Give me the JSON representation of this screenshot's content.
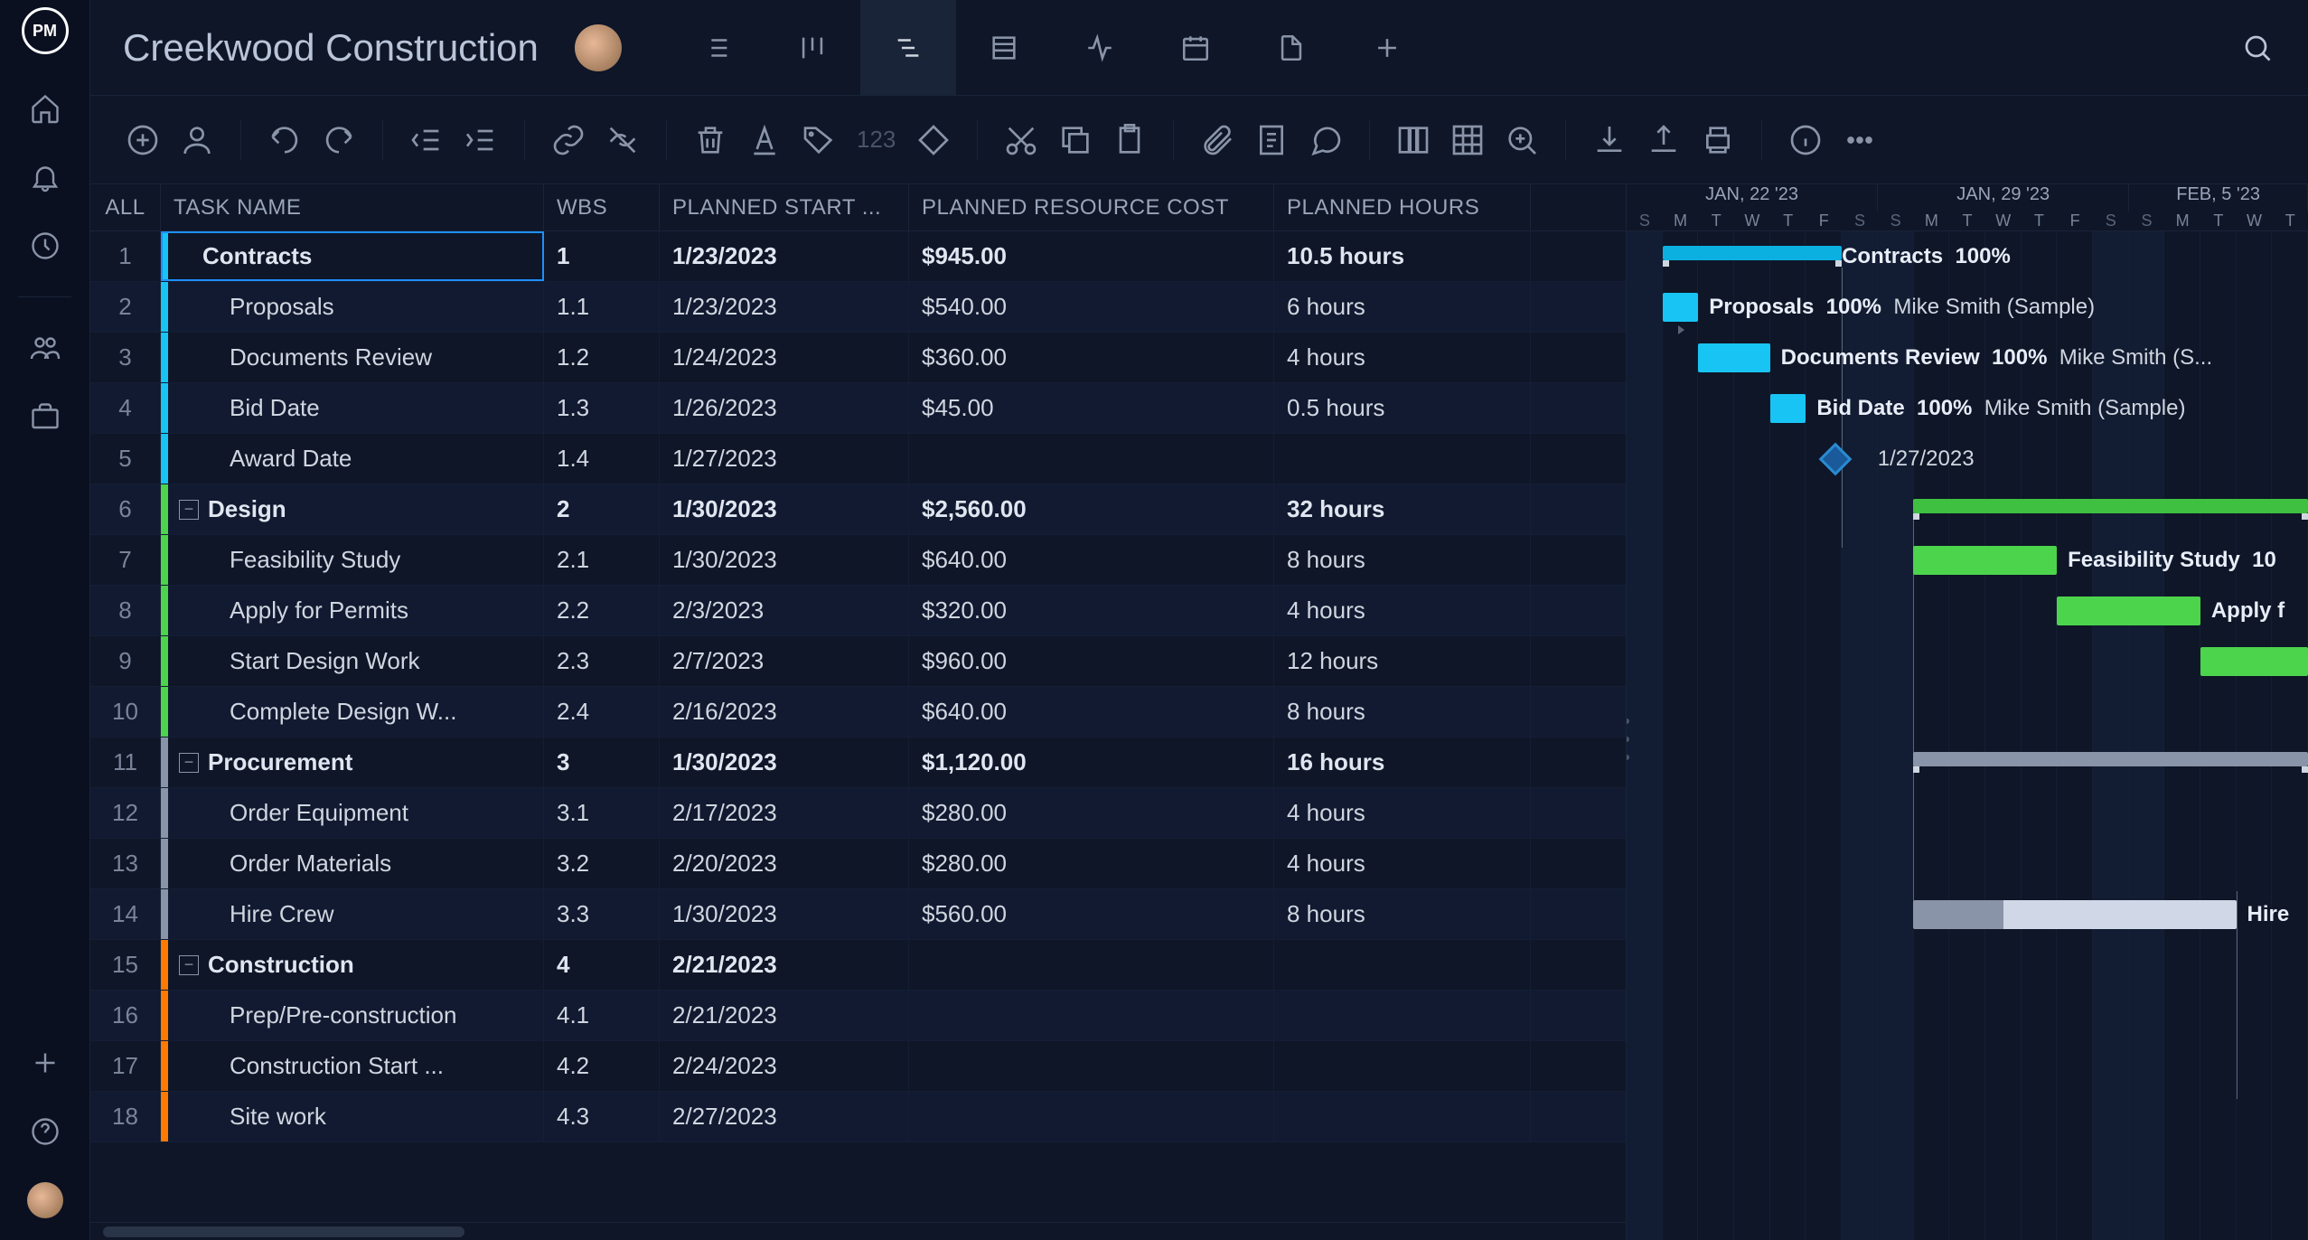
{
  "project": {
    "title": "Creekwood Construction"
  },
  "left_rail": {
    "logo": "PM",
    "items": [
      "home",
      "notifications",
      "activity",
      "",
      "users",
      "briefcase",
      "",
      "add",
      "",
      "help",
      "avatar"
    ]
  },
  "columns": {
    "row": "ALL",
    "task": "TASK NAME",
    "wbs": "WBS",
    "start": "PLANNED START ...",
    "cost": "PLANNED RESOURCE COST",
    "hours": "PLANNED HOURS"
  },
  "tasks": [
    {
      "n": 1,
      "name": "Contracts",
      "wbs": "1",
      "start": "1/23/2023",
      "cost": "$945.00",
      "hours": "10.5 hours",
      "color": "#18c4f4",
      "bold": true,
      "indent": 1,
      "selected": true
    },
    {
      "n": 2,
      "name": "Proposals",
      "wbs": "1.1",
      "start": "1/23/2023",
      "cost": "$540.00",
      "hours": "6 hours",
      "color": "#18c4f4",
      "indent": 2
    },
    {
      "n": 3,
      "name": "Documents Review",
      "wbs": "1.2",
      "start": "1/24/2023",
      "cost": "$360.00",
      "hours": "4 hours",
      "color": "#18c4f4",
      "indent": 2
    },
    {
      "n": 4,
      "name": "Bid Date",
      "wbs": "1.3",
      "start": "1/26/2023",
      "cost": "$45.00",
      "hours": "0.5 hours",
      "color": "#18c4f4",
      "indent": 2
    },
    {
      "n": 5,
      "name": "Award Date",
      "wbs": "1.4",
      "start": "1/27/2023",
      "cost": "",
      "hours": "",
      "color": "#18c4f4",
      "indent": 2
    },
    {
      "n": 6,
      "name": "Design",
      "wbs": "2",
      "start": "1/30/2023",
      "cost": "$2,560.00",
      "hours": "32 hours",
      "color": "#4cd44c",
      "bold": true,
      "indent": 0,
      "collapse": true
    },
    {
      "n": 7,
      "name": "Feasibility Study",
      "wbs": "2.1",
      "start": "1/30/2023",
      "cost": "$640.00",
      "hours": "8 hours",
      "color": "#4cd44c",
      "indent": 2
    },
    {
      "n": 8,
      "name": "Apply for Permits",
      "wbs": "2.2",
      "start": "2/3/2023",
      "cost": "$320.00",
      "hours": "4 hours",
      "color": "#4cd44c",
      "indent": 2
    },
    {
      "n": 9,
      "name": "Start Design Work",
      "wbs": "2.3",
      "start": "2/7/2023",
      "cost": "$960.00",
      "hours": "12 hours",
      "color": "#4cd44c",
      "indent": 2
    },
    {
      "n": 10,
      "name": "Complete Design W...",
      "wbs": "2.4",
      "start": "2/16/2023",
      "cost": "$640.00",
      "hours": "8 hours",
      "color": "#4cd44c",
      "indent": 2
    },
    {
      "n": 11,
      "name": "Procurement",
      "wbs": "3",
      "start": "1/30/2023",
      "cost": "$1,120.00",
      "hours": "16 hours",
      "color": "#8a94a8",
      "bold": true,
      "indent": 0,
      "collapse": true
    },
    {
      "n": 12,
      "name": "Order Equipment",
      "wbs": "3.1",
      "start": "2/17/2023",
      "cost": "$280.00",
      "hours": "4 hours",
      "color": "#8a94a8",
      "indent": 2
    },
    {
      "n": 13,
      "name": "Order Materials",
      "wbs": "3.2",
      "start": "2/20/2023",
      "cost": "$280.00",
      "hours": "4 hours",
      "color": "#8a94a8",
      "indent": 2
    },
    {
      "n": 14,
      "name": "Hire Crew",
      "wbs": "3.3",
      "start": "1/30/2023",
      "cost": "$560.00",
      "hours": "8 hours",
      "color": "#8a94a8",
      "indent": 2
    },
    {
      "n": 15,
      "name": "Construction",
      "wbs": "4",
      "start": "2/21/2023",
      "cost": "",
      "hours": "",
      "color": "#ff7a00",
      "bold": true,
      "indent": 0,
      "collapse": true
    },
    {
      "n": 16,
      "name": "Prep/Pre-construction",
      "wbs": "4.1",
      "start": "2/21/2023",
      "cost": "",
      "hours": "",
      "color": "#ff7a00",
      "indent": 2
    },
    {
      "n": 17,
      "name": "Construction Start ...",
      "wbs": "4.2",
      "start": "2/24/2023",
      "cost": "",
      "hours": "",
      "color": "#ff7a00",
      "indent": 2
    },
    {
      "n": 18,
      "name": "Site work",
      "wbs": "4.3",
      "start": "2/27/2023",
      "cost": "",
      "hours": "",
      "color": "#ff7a00",
      "indent": 2
    }
  ],
  "timeline": {
    "weeks": [
      "JAN, 22 '23",
      "JAN, 29 '23",
      "FEB, 5 '23"
    ],
    "days": [
      "S",
      "M",
      "T",
      "W",
      "T",
      "F",
      "S",
      "S",
      "M",
      "T",
      "W",
      "T",
      "F",
      "S",
      "S",
      "M",
      "T",
      "W",
      "T"
    ]
  },
  "gantt_labels": {
    "contracts": {
      "name": "Contracts",
      "pct": "100%",
      "res": ""
    },
    "proposals": {
      "name": "Proposals",
      "pct": "100%",
      "res": "Mike Smith (Sample)"
    },
    "documents": {
      "name": "Documents Review",
      "pct": "100%",
      "res": "Mike Smith (S..."
    },
    "biddate": {
      "name": "Bid Date",
      "pct": "100%",
      "res": "Mike Smith (Sample)"
    },
    "award": {
      "date": "1/27/2023"
    },
    "feasibility": {
      "name": "Feasibility Study",
      "pct": "10"
    },
    "apply": {
      "name": "Apply f"
    },
    "hire": {
      "name": "Hire"
    }
  },
  "toolbar_placeholder": "123"
}
